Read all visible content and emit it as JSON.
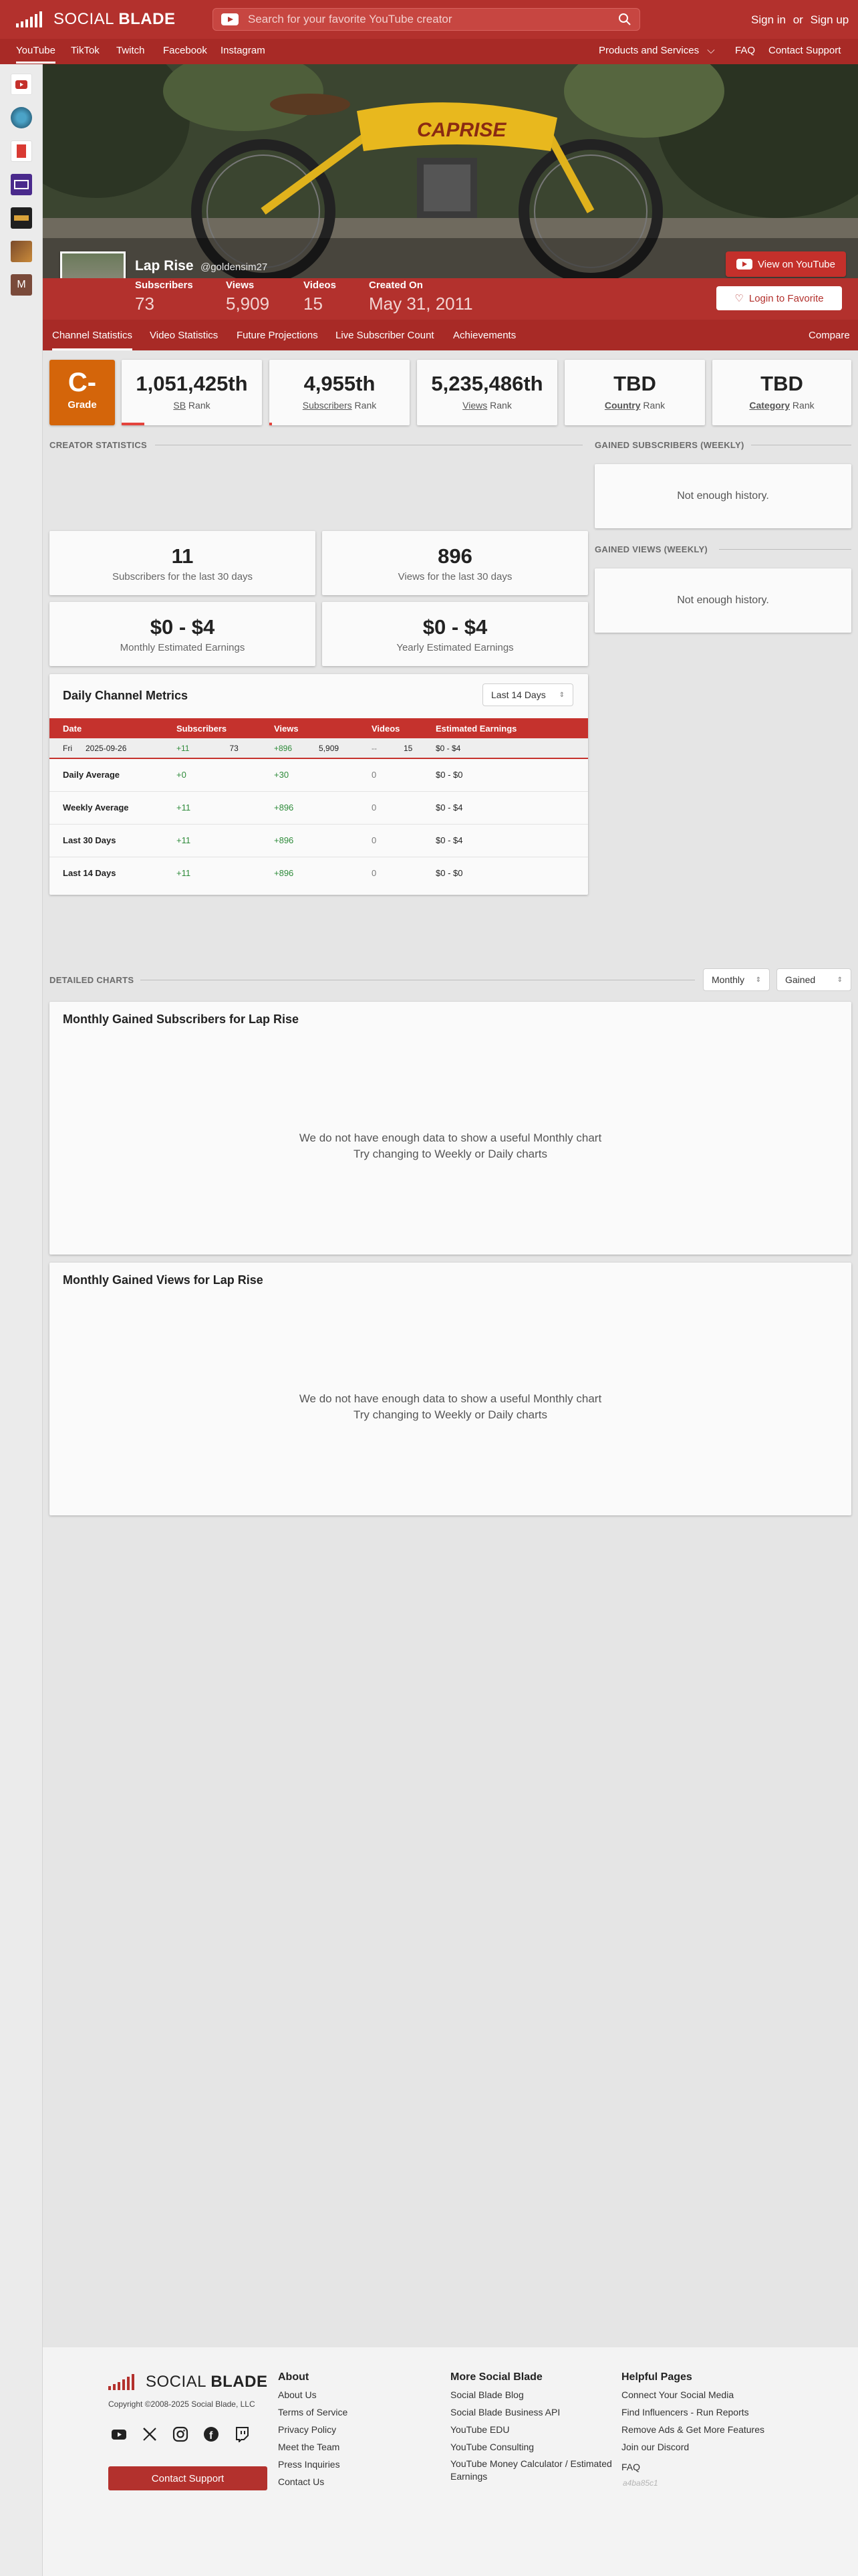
{
  "header": {
    "logo_text_light": "SOCIAL ",
    "logo_text_bold": "BLADE",
    "search_placeholder": "Search for your favorite YouTube creator",
    "sign_in": "Sign in",
    "or": "or",
    "sign_up": "Sign up"
  },
  "nav": {
    "items": [
      "YouTube",
      "TikTok",
      "Twitch",
      "Facebook",
      "Instagram"
    ],
    "products": "Products and Services",
    "faq": "FAQ",
    "contact": "Contact Support"
  },
  "sidebar": {
    "icons": [
      "youtube-icon",
      "globe-icon",
      "calendar-icon",
      "film-icon",
      "news-icon",
      "bookmark-icon",
      "user-m-icon"
    ],
    "last_letter": "M"
  },
  "channel": {
    "name": "Lap Rise",
    "handle": "@goldensim27",
    "subscribers_label": "Subscribers",
    "subscribers": "73",
    "views_label": "Views",
    "views": "5,909",
    "videos_label": "Videos",
    "videos": "15",
    "created_label": "Created On",
    "created": "May 31, 2011",
    "view_on_youtube": "View on YouTube",
    "login_favorite": "Login to Favorite",
    "banner_text": "CAPRISE"
  },
  "tabs": {
    "items": [
      "Channel Statistics",
      "Video Statistics",
      "Future Projections",
      "Live Subscriber Count",
      "Achievements"
    ],
    "compare": "Compare"
  },
  "grade": {
    "letter": "C-",
    "label": "Grade",
    "color": "#d4650a"
  },
  "ranks": [
    {
      "value": "1,051,425th",
      "prefix": "SB",
      "suffix": " Rank",
      "bar_fraction": 0.16
    },
    {
      "value": "4,955th",
      "prefix": "Subscribers",
      "suffix": " Rank",
      "bar_fraction": 0.02
    },
    {
      "value": "5,235,486th",
      "prefix": "Views",
      "suffix": " Rank",
      "bar_fraction": 0
    },
    {
      "value": "TBD",
      "prefix": "Country",
      "suffix": " Rank",
      "bar_fraction": 0
    },
    {
      "value": "TBD",
      "prefix": "Category",
      "suffix": " Rank",
      "bar_fraction": 0
    }
  ],
  "creator_stats": {
    "title": "Creator Statistics",
    "subs_30": "11",
    "subs_30_label": "Subscribers for the last 30 days",
    "views_30": "896",
    "views_30_label": "Views for the last 30 days",
    "monthly_earnings": "$0 - $4",
    "monthly_label": "Monthly Estimated Earnings",
    "yearly_earnings": "$0 - $4",
    "yearly_label": "Yearly Estimated Earnings"
  },
  "weekly": {
    "subs_title": "Gained Subscribers (Weekly)",
    "views_title": "Gained Views (Weekly)",
    "not_enough": "Not enough history."
  },
  "daily": {
    "title": "Daily Channel Metrics",
    "range": "Last 14 Days",
    "headers": [
      "Date",
      "Subscribers",
      "Views",
      "Videos",
      "Estimated Earnings"
    ],
    "row": {
      "day": "Fri",
      "date": "2025-09-26",
      "subs_delta": "+11",
      "subs_total": "73",
      "views_delta": "+896",
      "views_total": "5,909",
      "videos_delta": "--",
      "videos_total": "15",
      "earnings": "$0 - $4"
    },
    "summary": [
      {
        "label": "Daily Average",
        "subs": "+0",
        "views": "+30",
        "videos": "0",
        "earnings": "$0 - $0"
      },
      {
        "label": "Weekly Average",
        "subs": "+11",
        "views": "+896",
        "videos": "0",
        "earnings": "$0 - $4"
      },
      {
        "label": "Last 30 Days",
        "subs": "+11",
        "views": "+896",
        "videos": "0",
        "earnings": "$0 - $4"
      },
      {
        "label": "Last 14 Days",
        "subs": "+11",
        "views": "+896",
        "videos": "0",
        "earnings": "$0 - $0"
      }
    ]
  },
  "detailed": {
    "title": "Detailed Charts",
    "period": "Monthly",
    "mode": "Gained",
    "subs_chart_title": "Monthly Gained Subscribers for Lap Rise",
    "views_chart_title": "Monthly Gained Views for Lap Rise",
    "empty_line1": "We do not have enough data to show a useful Monthly chart",
    "empty_line2": "Try changing to Weekly or Daily charts"
  },
  "footer": {
    "logo_light": "SOCIAL ",
    "logo_bold": "BLADE",
    "copyright": "Copyright ©2008-2025 Social Blade, LLC",
    "contact": "Contact Support",
    "about_title": "About",
    "about": [
      "About Us",
      "Terms of Service",
      "Privacy Policy",
      "Meet the Team",
      "Press Inquiries",
      "Contact Us"
    ],
    "more_title": "More Social Blade",
    "more": [
      "Social Blade Blog",
      "Social Blade Business API",
      "YouTube EDU",
      "YouTube Consulting",
      "YouTube Money Calculator / Estimated Earnings"
    ],
    "help_title": "Helpful Pages",
    "help": [
      "Connect Your Social Media",
      "Find Influencers - Run Reports",
      "Remove Ads & Get More Features",
      "Join our Discord",
      "FAQ"
    ],
    "build": "a4ba85c1"
  },
  "colors": {
    "brand": "#b3312d",
    "brand_dark": "#a82a26",
    "positive": "#2e8b3a"
  }
}
